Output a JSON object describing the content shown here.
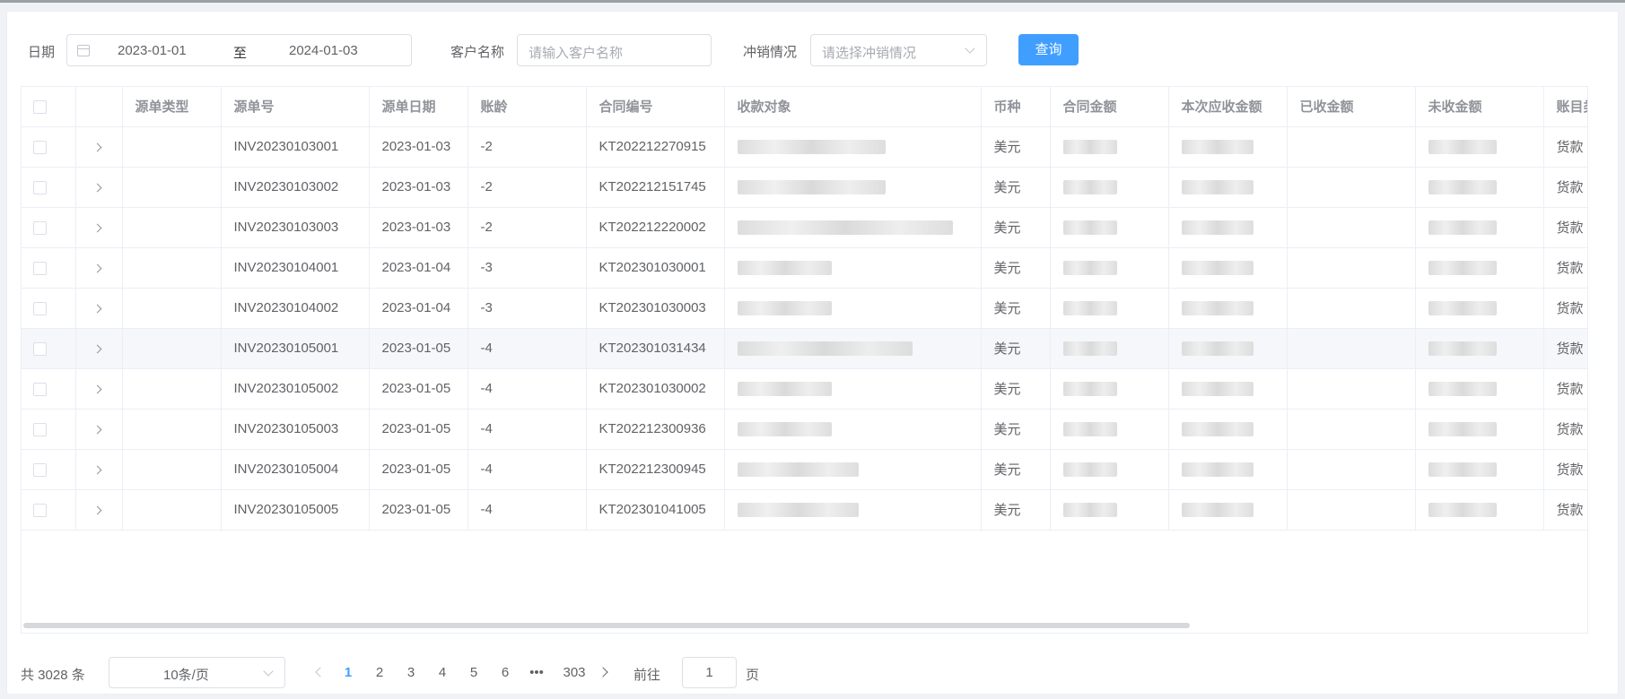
{
  "filters": {
    "date_label": "日期",
    "date_start": "2023-01-01",
    "date_sep": "至",
    "date_end": "2024-01-03",
    "customer_label": "客户名称",
    "customer_placeholder": "请输入客户名称",
    "writeoff_label": "冲销情况",
    "writeoff_placeholder": "请选择冲销情况",
    "query_button": "查询"
  },
  "table": {
    "columns": [
      "源单类型",
      "源单号",
      "源单日期",
      "账龄",
      "合同编号",
      "收款对象",
      "币种",
      "合同金额",
      "本次应收金额",
      "已收金额",
      "未收金额",
      "账目类"
    ],
    "rows": [
      {
        "doc_no": "INV20230103001",
        "date": "2023-01-03",
        "age": "-2",
        "contract": "KT202212270915",
        "currency": "美元",
        "account": "货款"
      },
      {
        "doc_no": "INV20230103002",
        "date": "2023-01-03",
        "age": "-2",
        "contract": "KT202212151745",
        "currency": "美元",
        "account": "货款"
      },
      {
        "doc_no": "INV20230103003",
        "date": "2023-01-03",
        "age": "-2",
        "contract": "KT202212220002",
        "currency": "美元",
        "account": "货款"
      },
      {
        "doc_no": "INV20230104001",
        "date": "2023-01-04",
        "age": "-3",
        "contract": "KT202301030001",
        "currency": "美元",
        "account": "货款"
      },
      {
        "doc_no": "INV20230104002",
        "date": "2023-01-04",
        "age": "-3",
        "contract": "KT202301030003",
        "currency": "美元",
        "account": "货款"
      },
      {
        "doc_no": "INV20230105001",
        "date": "2023-01-05",
        "age": "-4",
        "contract": "KT202301031434",
        "currency": "美元",
        "account": "货款"
      },
      {
        "doc_no": "INV20230105002",
        "date": "2023-01-05",
        "age": "-4",
        "contract": "KT202301030002",
        "currency": "美元",
        "account": "货款"
      },
      {
        "doc_no": "INV20230105003",
        "date": "2023-01-05",
        "age": "-4",
        "contract": "KT202212300936",
        "currency": "美元",
        "account": "货款"
      },
      {
        "doc_no": "INV20230105004",
        "date": "2023-01-05",
        "age": "-4",
        "contract": "KT202212300945",
        "currency": "美元",
        "account": "货款"
      },
      {
        "doc_no": "INV20230105005",
        "date": "2023-01-05",
        "age": "-4",
        "contract": "KT202301041005",
        "currency": "美元",
        "account": "货款"
      }
    ]
  },
  "pagination": {
    "total": "共 3028 条",
    "page_size": "10条/页",
    "pages": [
      "1",
      "2",
      "3",
      "4",
      "5",
      "6",
      "•••",
      "303"
    ],
    "goto_label": "前往",
    "goto_value": "1",
    "page_unit": "页"
  },
  "colors": {
    "accent": "#409eff",
    "border": "#ebeef5"
  }
}
